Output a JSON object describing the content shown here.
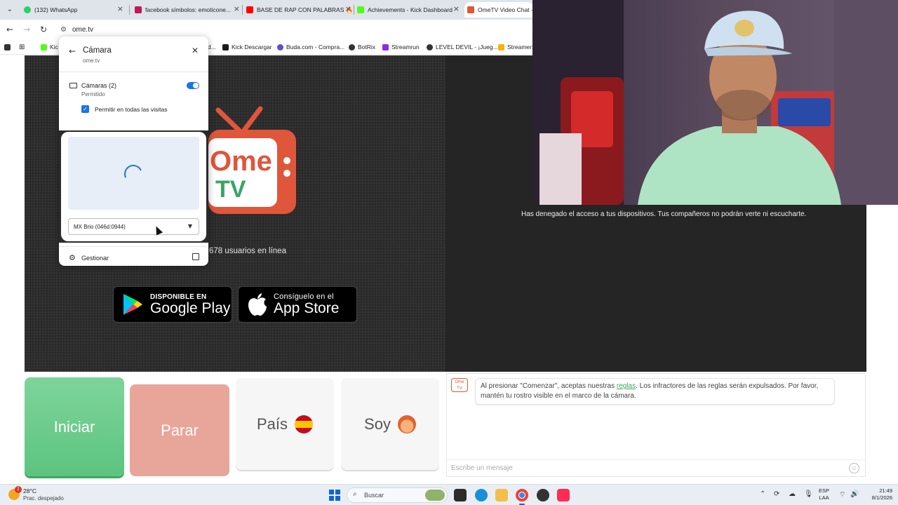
{
  "browser": {
    "tabs": [
      {
        "label": "(132) WhatsApp",
        "color": "#25d366"
      },
      {
        "label": "facebook símbolos: emoticone...",
        "color": "#c2185b"
      },
      {
        "label": "BASE DE RAP CON PALABRAS 🔥",
        "color": "#ff0000"
      },
      {
        "label": "Achievements - Kick Dashboard",
        "color": "#53fc18"
      },
      {
        "label": "OmeTV Video Chat —",
        "color": "#e0563b"
      }
    ],
    "url": "ome.tv",
    "bookmarks": [
      {
        "label": "Kic",
        "color": "#53fc18"
      },
      {
        "label": "d...",
        "color": "#ffffff"
      },
      {
        "label": "Kick Descargar",
        "color": "#1a1a1a"
      },
      {
        "label": "Buda.com - Compra...",
        "color": "#5b4bdb"
      },
      {
        "label": "BotRix",
        "color": "#333333"
      },
      {
        "label": "Streamrun",
        "color": "#8a2be2"
      },
      {
        "label": "LEVEL DEVIL - ¡Jueg...",
        "color": "#333333"
      },
      {
        "label": "StreamerS",
        "color": "#f4b400"
      }
    ]
  },
  "site": {
    "logo": {
      "line1": "Ome",
      "line2": "TV"
    },
    "online_text": "678 usuarios en línea",
    "google_play": {
      "small": "DISPONIBLE EN",
      "big": "Google Play"
    },
    "app_store": {
      "small": "Consíguelo en el",
      "big": "App Store"
    },
    "denied_message": "Has denegado el acceso a tus dispositivos. Tus compañeros no podrán verte ni escucharte.",
    "buttons": {
      "start": "Iniciar",
      "stop": "Parar",
      "country": "País",
      "me": "Soy"
    },
    "chat": {
      "avatar": "Ome TV",
      "message_before": "Al presionar \"Comenzar\", aceptas nuestras ",
      "message_link": "reglas",
      "message_after": ". Los infractores de las reglas serán expulsados. Por favor, mantén tu rostro visible en el marco de la cámara.",
      "placeholder": "Escribe un mensaje"
    }
  },
  "popup": {
    "title": "Cámara",
    "subtitle": "ome.tv",
    "camera_label": "Cámaras (2)",
    "camera_status": "Permitido",
    "camera_enabled": true,
    "allow_all": "Permitir en todas las visitas",
    "allow_all_checked": true,
    "device": "MX Brio (046d:0944)",
    "manage": "Gestionar"
  },
  "taskbar": {
    "temperature": "28°C",
    "weather": "Prac. despejado",
    "search": "Buscar",
    "language_line1": "ESP",
    "language_line2": "LAA",
    "time": "21:49",
    "date": "8/1/2026"
  }
}
